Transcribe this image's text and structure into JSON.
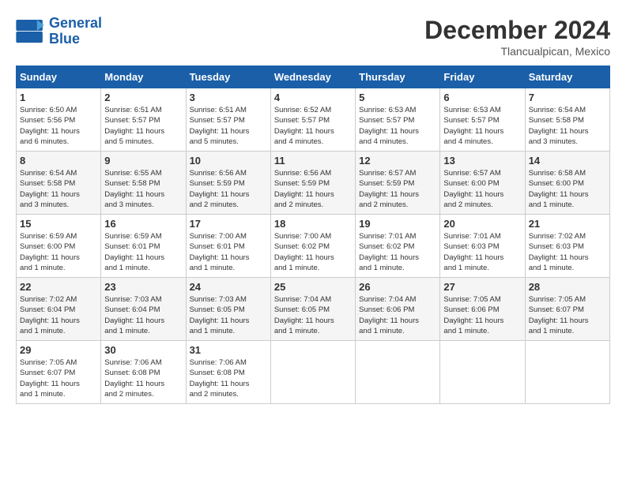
{
  "logo": {
    "line1": "General",
    "line2": "Blue"
  },
  "header": {
    "month_year": "December 2024",
    "location": "Tlancualpican, Mexico"
  },
  "days_of_week": [
    "Sunday",
    "Monday",
    "Tuesday",
    "Wednesday",
    "Thursday",
    "Friday",
    "Saturday"
  ],
  "weeks": [
    [
      {
        "day": "1",
        "info": "Sunrise: 6:50 AM\nSunset: 5:56 PM\nDaylight: 11 hours\nand 6 minutes."
      },
      {
        "day": "2",
        "info": "Sunrise: 6:51 AM\nSunset: 5:57 PM\nDaylight: 11 hours\nand 5 minutes."
      },
      {
        "day": "3",
        "info": "Sunrise: 6:51 AM\nSunset: 5:57 PM\nDaylight: 11 hours\nand 5 minutes."
      },
      {
        "day": "4",
        "info": "Sunrise: 6:52 AM\nSunset: 5:57 PM\nDaylight: 11 hours\nand 4 minutes."
      },
      {
        "day": "5",
        "info": "Sunrise: 6:53 AM\nSunset: 5:57 PM\nDaylight: 11 hours\nand 4 minutes."
      },
      {
        "day": "6",
        "info": "Sunrise: 6:53 AM\nSunset: 5:57 PM\nDaylight: 11 hours\nand 4 minutes."
      },
      {
        "day": "7",
        "info": "Sunrise: 6:54 AM\nSunset: 5:58 PM\nDaylight: 11 hours\nand 3 minutes."
      }
    ],
    [
      {
        "day": "8",
        "info": "Sunrise: 6:54 AM\nSunset: 5:58 PM\nDaylight: 11 hours\nand 3 minutes."
      },
      {
        "day": "9",
        "info": "Sunrise: 6:55 AM\nSunset: 5:58 PM\nDaylight: 11 hours\nand 3 minutes."
      },
      {
        "day": "10",
        "info": "Sunrise: 6:56 AM\nSunset: 5:59 PM\nDaylight: 11 hours\nand 2 minutes."
      },
      {
        "day": "11",
        "info": "Sunrise: 6:56 AM\nSunset: 5:59 PM\nDaylight: 11 hours\nand 2 minutes."
      },
      {
        "day": "12",
        "info": "Sunrise: 6:57 AM\nSunset: 5:59 PM\nDaylight: 11 hours\nand 2 minutes."
      },
      {
        "day": "13",
        "info": "Sunrise: 6:57 AM\nSunset: 6:00 PM\nDaylight: 11 hours\nand 2 minutes."
      },
      {
        "day": "14",
        "info": "Sunrise: 6:58 AM\nSunset: 6:00 PM\nDaylight: 11 hours\nand 1 minute."
      }
    ],
    [
      {
        "day": "15",
        "info": "Sunrise: 6:59 AM\nSunset: 6:00 PM\nDaylight: 11 hours\nand 1 minute."
      },
      {
        "day": "16",
        "info": "Sunrise: 6:59 AM\nSunset: 6:01 PM\nDaylight: 11 hours\nand 1 minute."
      },
      {
        "day": "17",
        "info": "Sunrise: 7:00 AM\nSunset: 6:01 PM\nDaylight: 11 hours\nand 1 minute."
      },
      {
        "day": "18",
        "info": "Sunrise: 7:00 AM\nSunset: 6:02 PM\nDaylight: 11 hours\nand 1 minute."
      },
      {
        "day": "19",
        "info": "Sunrise: 7:01 AM\nSunset: 6:02 PM\nDaylight: 11 hours\nand 1 minute."
      },
      {
        "day": "20",
        "info": "Sunrise: 7:01 AM\nSunset: 6:03 PM\nDaylight: 11 hours\nand 1 minute."
      },
      {
        "day": "21",
        "info": "Sunrise: 7:02 AM\nSunset: 6:03 PM\nDaylight: 11 hours\nand 1 minute."
      }
    ],
    [
      {
        "day": "22",
        "info": "Sunrise: 7:02 AM\nSunset: 6:04 PM\nDaylight: 11 hours\nand 1 minute."
      },
      {
        "day": "23",
        "info": "Sunrise: 7:03 AM\nSunset: 6:04 PM\nDaylight: 11 hours\nand 1 minute."
      },
      {
        "day": "24",
        "info": "Sunrise: 7:03 AM\nSunset: 6:05 PM\nDaylight: 11 hours\nand 1 minute."
      },
      {
        "day": "25",
        "info": "Sunrise: 7:04 AM\nSunset: 6:05 PM\nDaylight: 11 hours\nand 1 minute."
      },
      {
        "day": "26",
        "info": "Sunrise: 7:04 AM\nSunset: 6:06 PM\nDaylight: 11 hours\nand 1 minute."
      },
      {
        "day": "27",
        "info": "Sunrise: 7:05 AM\nSunset: 6:06 PM\nDaylight: 11 hours\nand 1 minute."
      },
      {
        "day": "28",
        "info": "Sunrise: 7:05 AM\nSunset: 6:07 PM\nDaylight: 11 hours\nand 1 minute."
      }
    ],
    [
      {
        "day": "29",
        "info": "Sunrise: 7:05 AM\nSunset: 6:07 PM\nDaylight: 11 hours\nand 1 minute."
      },
      {
        "day": "30",
        "info": "Sunrise: 7:06 AM\nSunset: 6:08 PM\nDaylight: 11 hours\nand 2 minutes."
      },
      {
        "day": "31",
        "info": "Sunrise: 7:06 AM\nSunset: 6:08 PM\nDaylight: 11 hours\nand 2 minutes."
      },
      {
        "day": "",
        "info": ""
      },
      {
        "day": "",
        "info": ""
      },
      {
        "day": "",
        "info": ""
      },
      {
        "day": "",
        "info": ""
      }
    ]
  ]
}
